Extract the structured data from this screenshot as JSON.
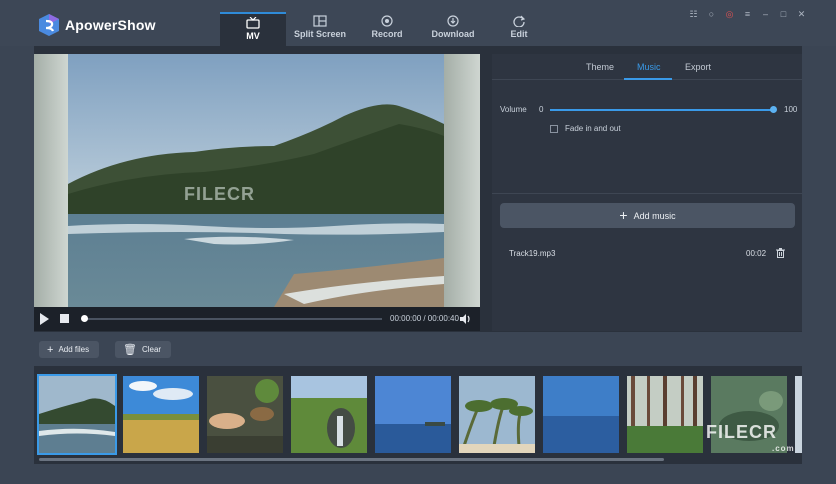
{
  "app": {
    "title": "ApowerShow"
  },
  "nav": [
    {
      "label": "MV",
      "icon": "tv-icon",
      "active": true
    },
    {
      "label": "Split Screen",
      "icon": "split-screen-icon",
      "active": false
    },
    {
      "label": "Record",
      "icon": "record-icon",
      "active": false
    },
    {
      "label": "Download",
      "icon": "download-icon",
      "active": false
    },
    {
      "label": "Edit",
      "icon": "edit-icon",
      "active": false
    }
  ],
  "window_controls": [
    "cart-icon",
    "user-icon",
    "notification-icon",
    "menu-icon",
    "minimize-icon",
    "maximize-icon",
    "close-icon"
  ],
  "player": {
    "time": "00:00:00 / 00:00:40",
    "progress": 0
  },
  "panel": {
    "tabs": [
      {
        "label": "Theme"
      },
      {
        "label": "Music",
        "active": true
      },
      {
        "label": "Export"
      }
    ],
    "volume_label": "Volume",
    "volume_min": "0",
    "volume_max": "100",
    "volume_value": 100,
    "fade_label": "Fade in and out",
    "fade_checked": false,
    "add_music_label": "Add music",
    "track": {
      "name": "Track19.mp3",
      "duration": "00:02"
    }
  },
  "toolbar": {
    "add_files_label": "Add files",
    "clear_label": "Clear"
  },
  "watermark": {
    "text": "FILECR",
    "sub": ".com"
  },
  "colors": {
    "accent": "#3a9ae8",
    "background": "#3b4554",
    "panel": "#2e3541"
  },
  "thumbnails": [
    {
      "name": "mountain-sea",
      "selected": true
    },
    {
      "name": "wheat-field"
    },
    {
      "name": "hand-rocks"
    },
    {
      "name": "waterfall-green"
    },
    {
      "name": "blue-sea"
    },
    {
      "name": "palm-beach"
    },
    {
      "name": "ocean-horizon"
    },
    {
      "name": "forest-lake"
    },
    {
      "name": "coast-rocks"
    }
  ]
}
